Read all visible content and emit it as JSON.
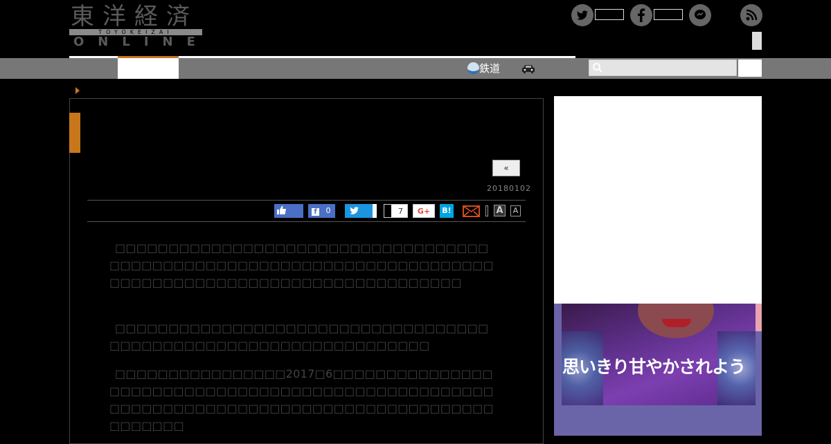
{
  "header": {
    "logo_kanji": "東洋経済",
    "logo_sub": "TOYOKEIZAI",
    "logo_online": "ONLINE",
    "social_icons": [
      "twitter-icon",
      "facebook-icon",
      "messenger-icon",
      "rss-icon"
    ]
  },
  "nav": {
    "items": [
      {
        "label": "鉄道",
        "icon": "train-icon"
      },
      {
        "label": "",
        "icon": "car-icon"
      }
    ]
  },
  "article": {
    "prev_label": "«",
    "date": "20180102",
    "share": {
      "like_count": "",
      "facebook_count": "0",
      "twitter_count": "",
      "hatena_count": "7",
      "gplus_label": "G+",
      "hatena_label": "B!",
      "font_large": "A",
      "font_small": "A"
    },
    "paragraphs": [
      "□□□□□□□□□□□□□□□□□□□□□□□□□□□□□□□□□□□□□□□□□□□□□□□□□□□□□□□□□□□□□□□□□□□□□□□□□□□□□□□□□□□□□□□□□□□□□□□□□□□□□□□□",
      "□□□□□□□□□□□□□□□□□□□□□□□□□□□□□□□□□□□□□□□□□□□□□□□□□□□□□□□□□□□□□□□□□",
      "□□□□□□□□□□□□□□□□2017□6□□□□□□□□□□□□□□□□□□□□□□□□□□□□□□□□□□□□□□□□□□□□□□□□□□□□□□□□□□□□□□□□□□□□□□□□□□□□□□□□□□□□□□□□□□□□□□"
    ]
  },
  "sidebar": {
    "ad_text": "思いきり甘やかされよう"
  },
  "colors": {
    "accent": "#c8761c",
    "nav_bg": "#777777",
    "background": "#000000"
  }
}
